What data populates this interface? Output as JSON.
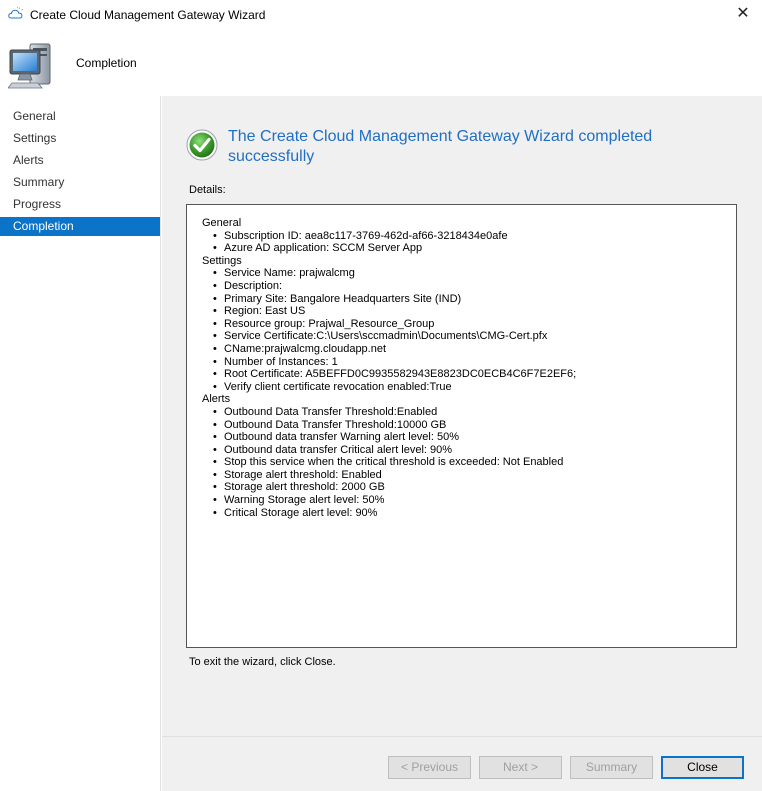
{
  "window": {
    "title": "Create Cloud Management Gateway Wizard",
    "close_glyph": "✕"
  },
  "header": {
    "page_heading": "Completion",
    "icon": "computer-icon"
  },
  "sidebar": {
    "items": [
      {
        "label": "General"
      },
      {
        "label": "Settings"
      },
      {
        "label": "Alerts"
      },
      {
        "label": "Summary"
      },
      {
        "label": "Progress"
      },
      {
        "label": "Completion",
        "active": true
      }
    ]
  },
  "main": {
    "success_title": "The Create Cloud Management Gateway Wizard completed successfully",
    "details_label": "Details:",
    "details": {
      "general_head": "General",
      "general": [
        "Subscription ID: aea8c117-3769-462d-af66-3218434e0afe",
        "Azure AD application: SCCM Server App"
      ],
      "settings_head": "Settings",
      "settings": [
        "Service Name: prajwalcmg",
        "Description:",
        "Primary Site: Bangalore Headquarters Site (IND)",
        "Region: East US",
        "Resource group: Prajwal_Resource_Group",
        "Service Certificate:C:\\Users\\sccmadmin\\Documents\\CMG-Cert.pfx",
        "CName:prajwalcmg.cloudapp.net",
        "Number of Instances: 1",
        "Root Certificate: A5BEFFD0C9935582943E8823DC0ECB4C6F7E2EF6;",
        "Verify client certificate revocation enabled:True"
      ],
      "alerts_head": "Alerts",
      "alerts": [
        "Outbound Data Transfer Threshold:Enabled",
        "Outbound Data Transfer Threshold:10000 GB",
        "Outbound data transfer Warning alert level: 50%",
        "Outbound data transfer Critical alert level: 90%",
        "Stop this service when the critical threshold is exceeded: Not Enabled",
        "Storage alert threshold: Enabled",
        "Storage alert threshold: 2000 GB",
        "Warning Storage alert level: 50%",
        "Critical Storage alert level: 90%"
      ]
    },
    "exit_hint": "To exit the wizard, click Close."
  },
  "footer": {
    "previous_label": "< Previous",
    "next_label": "Next >",
    "summary_label": "Summary",
    "close_label": "Close"
  },
  "colors": {
    "accent": "#0b73c8",
    "title_blue": "#1f6fc4",
    "success_green": "#3a9a2a"
  }
}
